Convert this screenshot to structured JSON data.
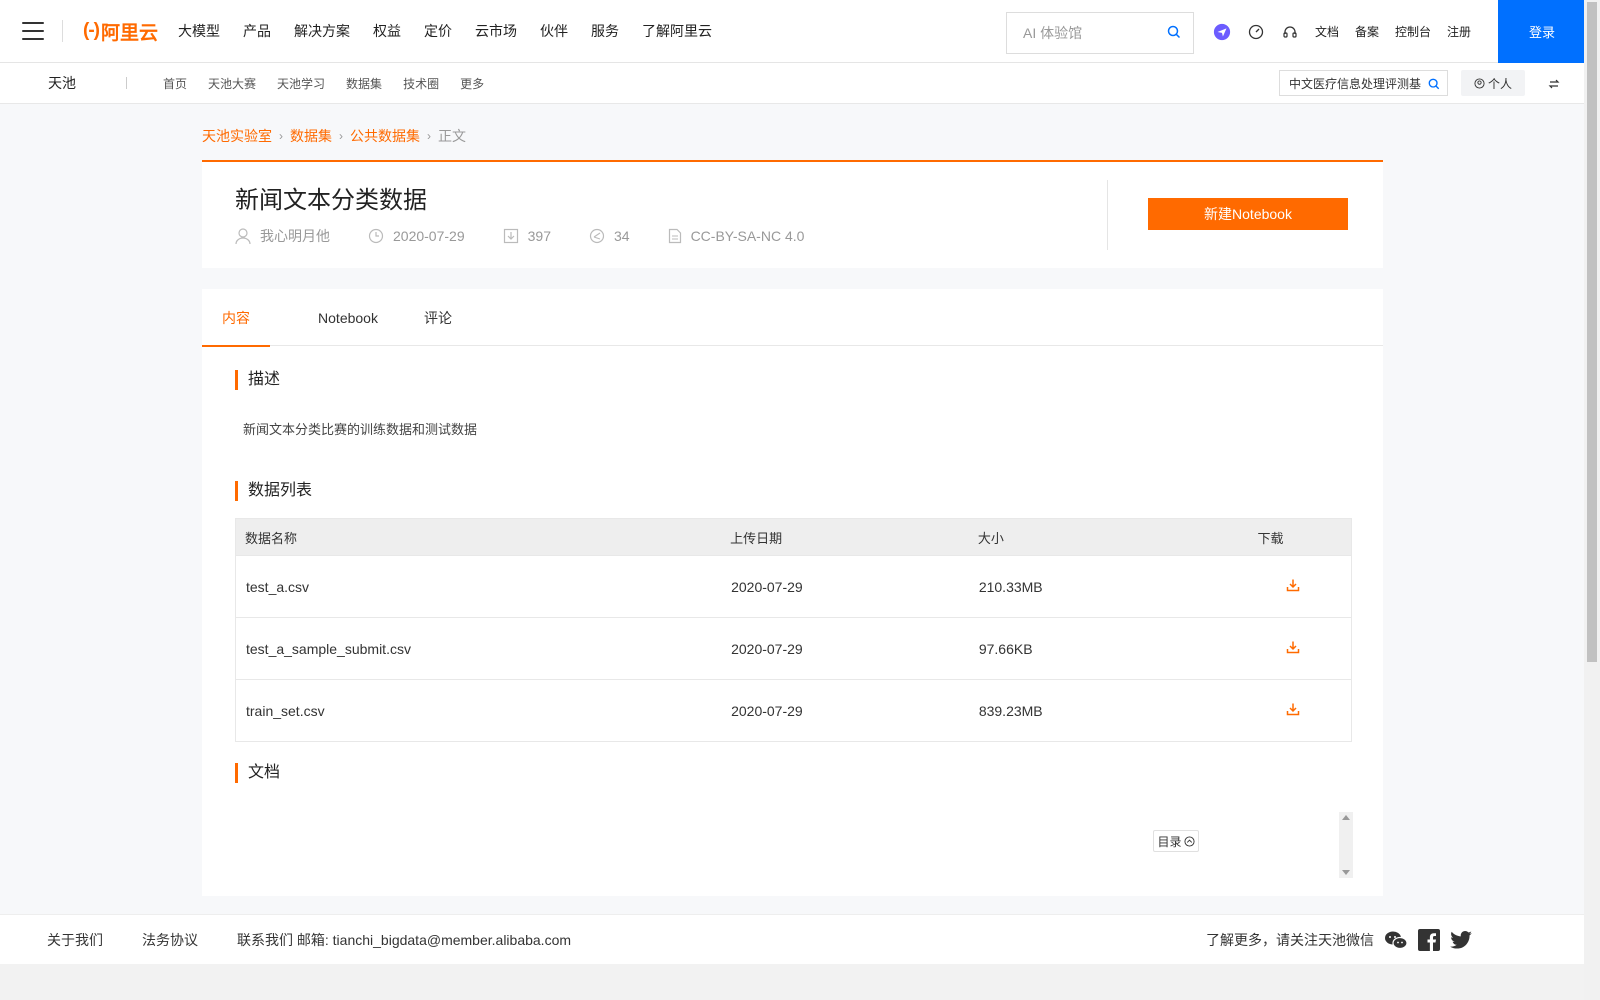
{
  "topnav": {
    "logo_text": "阿里云",
    "menu": [
      "大模型",
      "产品",
      "解决方案",
      "权益",
      "定价",
      "云市场",
      "伙伴",
      "服务",
      "了解阿里云"
    ],
    "search_placeholder": "AI 体验馆",
    "right_links": [
      "文档",
      "备案",
      "控制台",
      "注册"
    ],
    "login_label": "登录"
  },
  "subnav": {
    "brand": "天池",
    "links": [
      "首页",
      "天池大赛",
      "天池学习",
      "数据集",
      "技术圈",
      "更多"
    ],
    "search_value": "中文医疗信息处理评测基",
    "personal_label": "个人"
  },
  "breadcrumb": {
    "items": [
      "天池实验室",
      "数据集",
      "公共数据集"
    ],
    "current": "正文"
  },
  "dataset": {
    "title": "新闻文本分类数据",
    "author": "我心明月他",
    "date": "2020-07-29",
    "downloads": "397",
    "shares": "34",
    "license": "CC-BY-SA-NC 4.0",
    "notebook_button": "新建Notebook"
  },
  "tabs": [
    "内容",
    "Notebook",
    "评论"
  ],
  "sections": {
    "description_title": "描述",
    "description_text": "新闻文本分类比赛的训练数据和测试数据",
    "datalist_title": "数据列表",
    "docs_title": "文档",
    "toc_label": "目录"
  },
  "table": {
    "headers": [
      "数据名称",
      "上传日期",
      "大小",
      "下载"
    ],
    "rows": [
      {
        "name": "test_a.csv",
        "date": "2020-07-29",
        "size": "210.33MB"
      },
      {
        "name": "test_a_sample_submit.csv",
        "date": "2020-07-29",
        "size": "97.66KB"
      },
      {
        "name": "train_set.csv",
        "date": "2020-07-29",
        "size": "839.23MB"
      }
    ]
  },
  "footer": {
    "links": [
      "关于我们",
      "法务协议"
    ],
    "contact": "联系我们 邮箱: tianchi_bigdata@member.alibaba.com",
    "follow_text": "了解更多，请关注天池微信"
  },
  "colors": {
    "accent": "#ff6a00",
    "login": "#0070ff"
  }
}
